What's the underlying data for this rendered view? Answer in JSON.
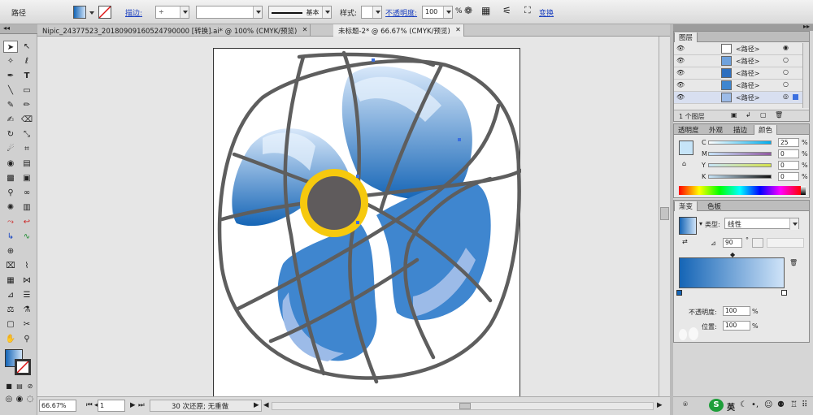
{
  "control_bar": {
    "object_type": "路径",
    "stroke_label": "描边:",
    "stroke_style": "基本",
    "style_label": "样式:",
    "opacity_label": "不透明度:",
    "opacity_value": "100",
    "opacity_unit": "%",
    "transform_label": "变换"
  },
  "tabs": [
    {
      "label": "Nipic_24377523_20180909160524790000  [转换].ai* @ 100% (CMYK/预览)",
      "close": "✕"
    },
    {
      "label": "未标题-2* @ 66.67% (CMYK/预览)",
      "close": "✕"
    }
  ],
  "status_bar": {
    "zoom": "66.67%",
    "page": "1",
    "history": "30 次还原; 无重做"
  },
  "layers_panel": {
    "title": "图层",
    "items": [
      {
        "name": "<路径>"
      },
      {
        "name": "<路径>"
      },
      {
        "name": "<路径>"
      },
      {
        "name": "<路径>"
      },
      {
        "name": "<路径>"
      }
    ],
    "footer": "1 个图层"
  },
  "color_panel": {
    "tabs": [
      "透明度",
      "外观",
      "描边",
      "颜色"
    ],
    "channels": [
      {
        "label": "C",
        "value": "25",
        "unit": "%"
      },
      {
        "label": "M",
        "value": "0",
        "unit": "%"
      },
      {
        "label": "Y",
        "value": "0",
        "unit": "%"
      },
      {
        "label": "K",
        "value": "0",
        "unit": "%"
      }
    ]
  },
  "gradient_panel": {
    "tabs": [
      "渐变",
      "色板"
    ],
    "type_label": "类型:",
    "type_value": "线性",
    "angle": "90",
    "angle_unit": "°",
    "opacity_label": "不透明度:",
    "opacity_value": "100",
    "location_label": "位置:",
    "location_value": "100",
    "unit": "%"
  },
  "taskbar": {
    "ime": "英"
  },
  "colors": {
    "blue_dark": "#1565b6",
    "blue_light": "#cfe3f8",
    "hub_ring": "#f6c90e",
    "hub": "#5f5b5c",
    "cage": "#5e5e5e"
  }
}
